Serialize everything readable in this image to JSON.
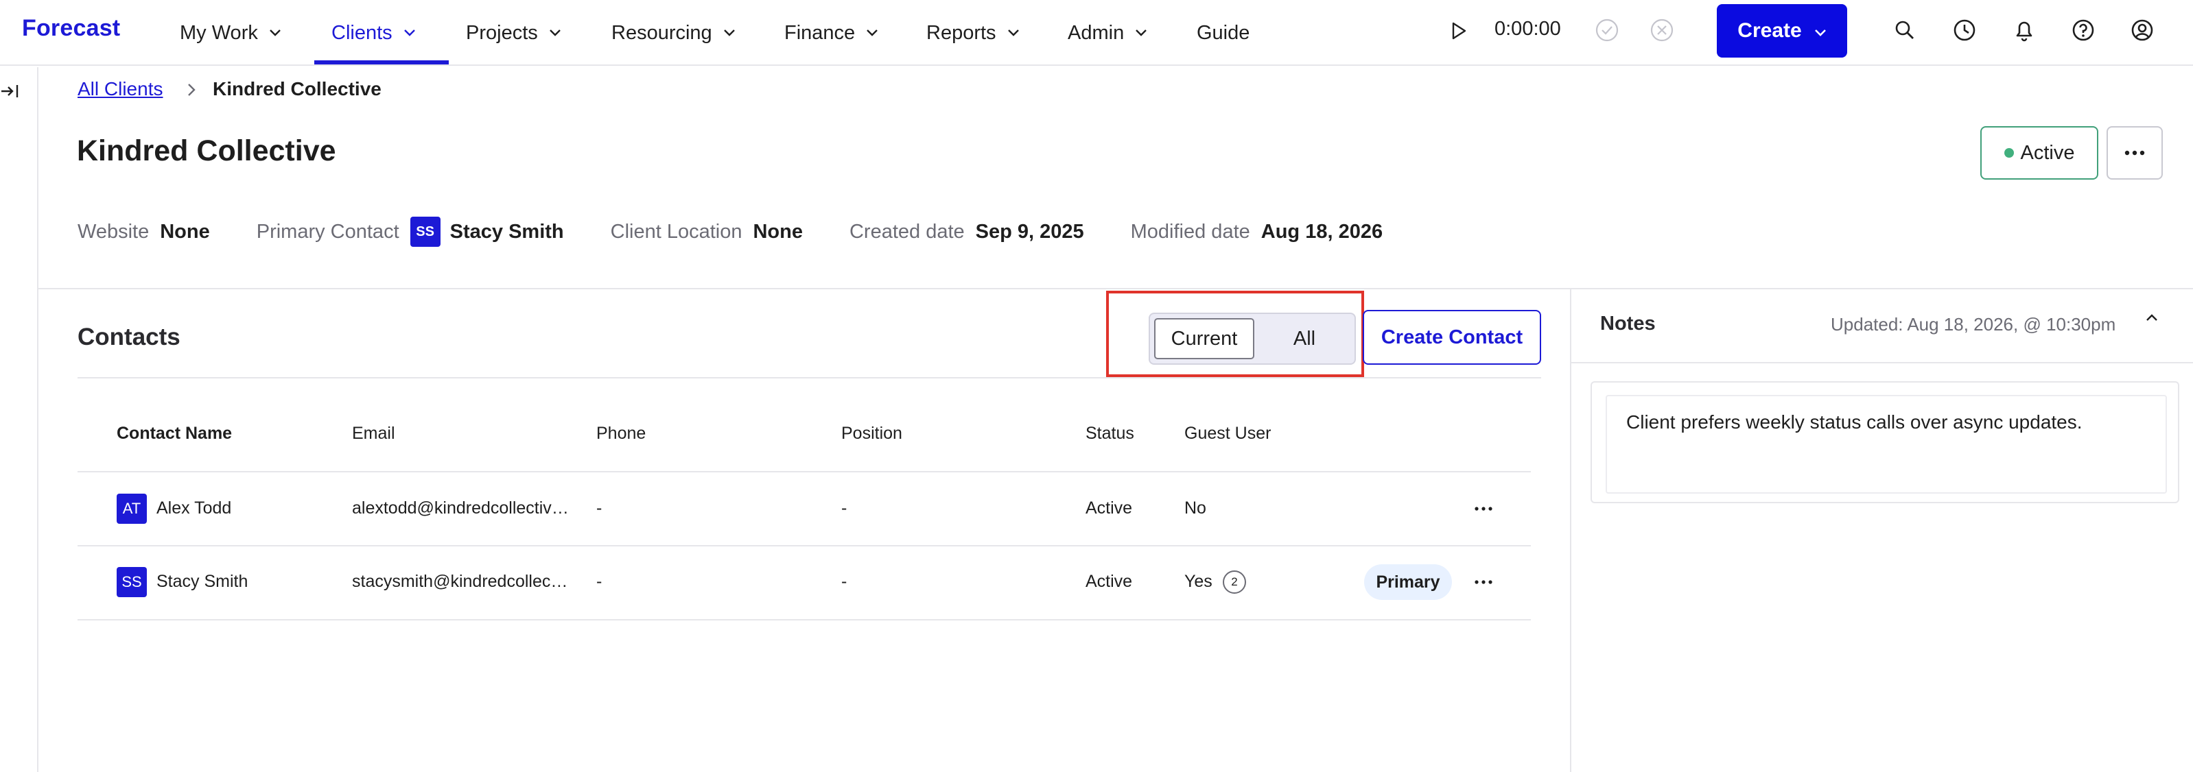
{
  "app": {
    "logo": "Forecast"
  },
  "nav": {
    "items": [
      {
        "label": "My Work"
      },
      {
        "label": "Clients"
      },
      {
        "label": "Projects"
      },
      {
        "label": "Resourcing"
      },
      {
        "label": "Finance"
      },
      {
        "label": "Reports"
      },
      {
        "label": "Admin"
      },
      {
        "label": "Guide"
      }
    ],
    "active": "Clients"
  },
  "timer": {
    "value": "0:00:00"
  },
  "create_button": {
    "label": "Create"
  },
  "top_icons": [
    "search-icon",
    "clock-icon",
    "bell-icon",
    "help-icon",
    "user-icon"
  ],
  "breadcrumb": {
    "parent": "All Clients",
    "current": "Kindred Collective"
  },
  "client": {
    "name": "Kindred Collective",
    "status": "Active",
    "meta": {
      "website_label": "Website",
      "website_value": "None",
      "primary_contact_label": "Primary Contact",
      "primary_contact_initials": "SS",
      "primary_contact_value": "Stacy Smith",
      "location_label": "Client Location",
      "location_value": "None",
      "created_label": "Created date",
      "created_value": "Sep 9, 2025",
      "modified_label": "Modified date",
      "modified_value": "Aug 18, 2026"
    }
  },
  "contacts": {
    "title": "Contacts",
    "toggle": {
      "current": "Current",
      "all": "All",
      "selected": "Current"
    },
    "create_label": "Create Contact",
    "columns": [
      "Contact Name",
      "Email",
      "Phone",
      "Position",
      "Status",
      "Guest User"
    ],
    "rows": [
      {
        "initials": "AT",
        "name": "Alex Todd",
        "email": "alextodd@kindredcollective.com",
        "phone": "-",
        "position": "-",
        "status": "Active",
        "guest": "No",
        "guest_count": "",
        "badge": ""
      },
      {
        "initials": "SS",
        "name": "Stacy Smith",
        "email": "stacysmith@kindredcollective.com",
        "phone": "-",
        "position": "-",
        "status": "Active",
        "guest": "Yes",
        "guest_count": "2",
        "badge": "Primary"
      }
    ]
  },
  "notes": {
    "title": "Notes",
    "updated": "Updated: Aug 18, 2026, @ 10:30pm",
    "text": "Client prefers weekly status calls over async updates."
  },
  "colors": {
    "brand": "#1d1ad6",
    "create_button": "#0b0be0",
    "active_green": "#41b07e",
    "highlight": "#e0332b"
  }
}
